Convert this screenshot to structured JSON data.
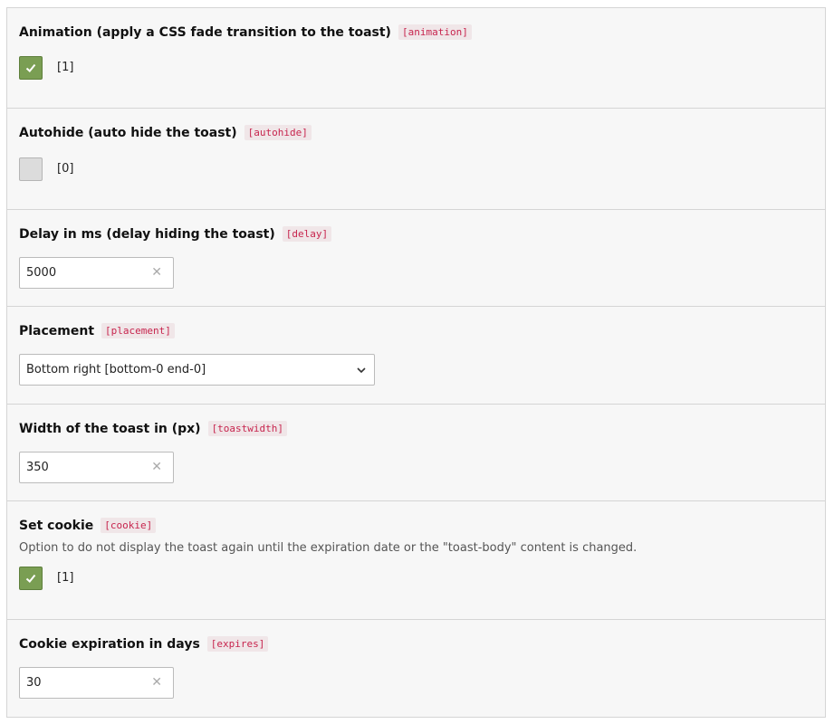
{
  "fields": [
    {
      "label": "Animation (apply a CSS fade transition to the toast)",
      "key": "[animation]",
      "checked": true,
      "value": "[1]"
    },
    {
      "label": "Autohide (auto hide the toast)",
      "key": "[autohide]",
      "checked": false,
      "value": "[0]"
    },
    {
      "label": "Delay in ms (delay hiding the toast)",
      "key": "[delay]",
      "value": "5000",
      "clear_icon": "close-icon"
    },
    {
      "label": "Placement",
      "key": "[placement]",
      "selected": "Bottom right [bottom-0 end-0]",
      "icon": "chevron-down-icon"
    },
    {
      "label": "Width of the toast in (px)",
      "key": "[toastwidth]",
      "value": "350",
      "clear_icon": "close-icon"
    },
    {
      "label": "Set cookie",
      "key": "[cookie]",
      "description": "Option to do not display the toast again until the expiration date or the \"toast-body\" content is changed.",
      "checked": true,
      "value": "[1]"
    },
    {
      "label": "Cookie expiration in days",
      "key": "[expires]",
      "value": "30",
      "clear_icon": "close-icon"
    }
  ],
  "colors": {
    "checkbox_checked": "#7a9e53",
    "checkbox_unchecked": "#dcdcdc",
    "key_text": "#c7254e",
    "panel_bg": "#f7f7f7",
    "border": "#d5d5d5"
  }
}
